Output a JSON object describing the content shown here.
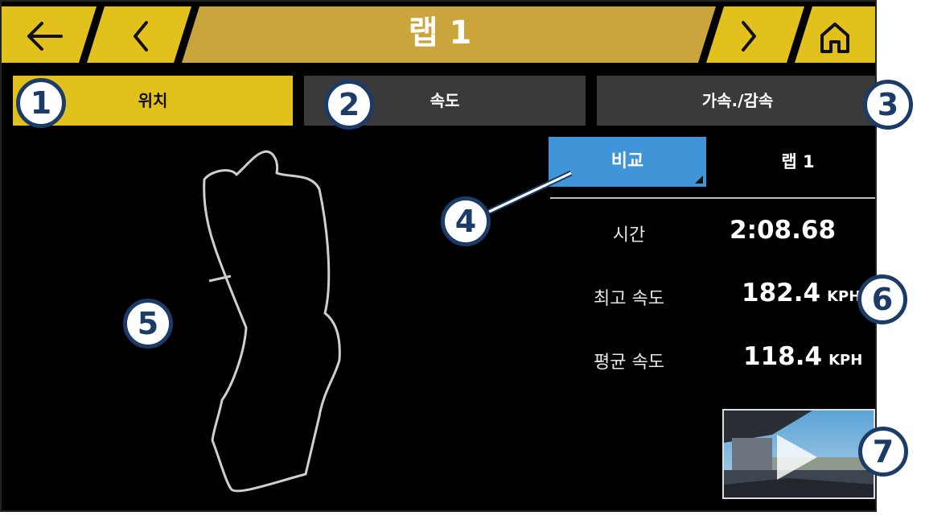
{
  "header": {
    "title": "랩 1",
    "back_icon": "back-arrow-icon",
    "prev_icon": "chevron-left-icon",
    "next_icon": "chevron-right-icon",
    "home_icon": "home-icon"
  },
  "tabs": [
    {
      "label": "위치",
      "active": true
    },
    {
      "label": "속도",
      "active": false
    },
    {
      "label": "가속./감속",
      "active": false
    }
  ],
  "compare": {
    "button_label": "비교",
    "lap_label": "랩 1"
  },
  "stats": [
    {
      "label": "시간",
      "value": "2:08.68",
      "unit": ""
    },
    {
      "label": "최고 속도",
      "value": "182.4",
      "unit": "KPH"
    },
    {
      "label": "평균 속도",
      "value": "118.4",
      "unit": "KPH"
    }
  ],
  "video_thumbnail": {
    "icon": "play-icon"
  },
  "callouts": [
    "1",
    "2",
    "3",
    "4",
    "5",
    "6",
    "7"
  ],
  "colors": {
    "accent_yellow": "#e3c11d",
    "header_gold": "#c9a53b",
    "compare_blue": "#3f95d8",
    "callout_navy": "#1c3b67"
  }
}
